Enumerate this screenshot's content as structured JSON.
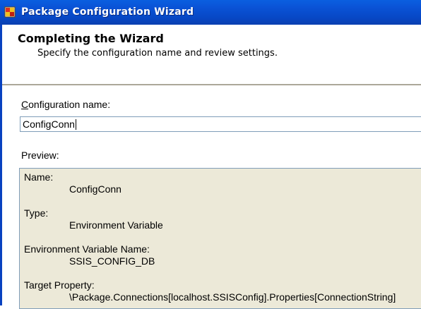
{
  "window": {
    "title": "Package Configuration Wizard"
  },
  "header": {
    "title": "Completing the Wizard",
    "subtitle": "Specify the configuration name and review settings."
  },
  "config_name": {
    "label_accel": "C",
    "label_rest": "onfiguration name:",
    "value": "ConfigConn"
  },
  "preview": {
    "label": "Preview:",
    "items": [
      {
        "label": "Name:",
        "value": "ConfigConn"
      },
      {
        "label": "Type:",
        "value": "Environment Variable"
      },
      {
        "label": "Environment Variable Name:",
        "value": "SSIS_CONFIG_DB"
      },
      {
        "label": "Target Property:",
        "value": "\\Package.Connections[localhost.SSISConfig].Properties[ConnectionString]"
      }
    ]
  }
}
